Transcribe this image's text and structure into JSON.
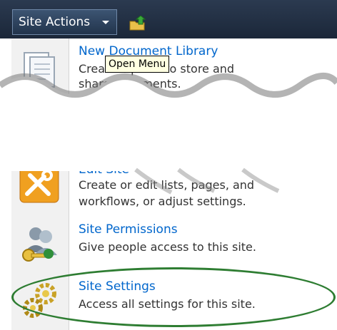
{
  "toolbar": {
    "site_actions_label": "Site Actions",
    "nav_up_icon": "folder-up-arrow-icon"
  },
  "tooltip": {
    "text": "Open Menu"
  },
  "menu": {
    "items": [
      {
        "title": "New Document Library",
        "desc_lines": [
          "Create a place to store and",
          "share documents."
        ],
        "icon": "document-library-icon"
      },
      {
        "title": "Edit Site",
        "desc_lines": [
          "Create or edit lists, pages, and",
          "workflows, or adjust settings."
        ],
        "icon": "tools-icon"
      },
      {
        "title": "Site Permissions",
        "desc_lines": [
          "Give people access to this site."
        ],
        "icon": "people-key-icon"
      },
      {
        "title": "Site Settings",
        "desc_lines": [
          "Access all settings for this site."
        ],
        "icon": "gears-icon"
      }
    ]
  },
  "colors": {
    "ribbon": "#1b2739",
    "link": "#0066cc",
    "highlight_ellipse": "#2e7d32"
  }
}
